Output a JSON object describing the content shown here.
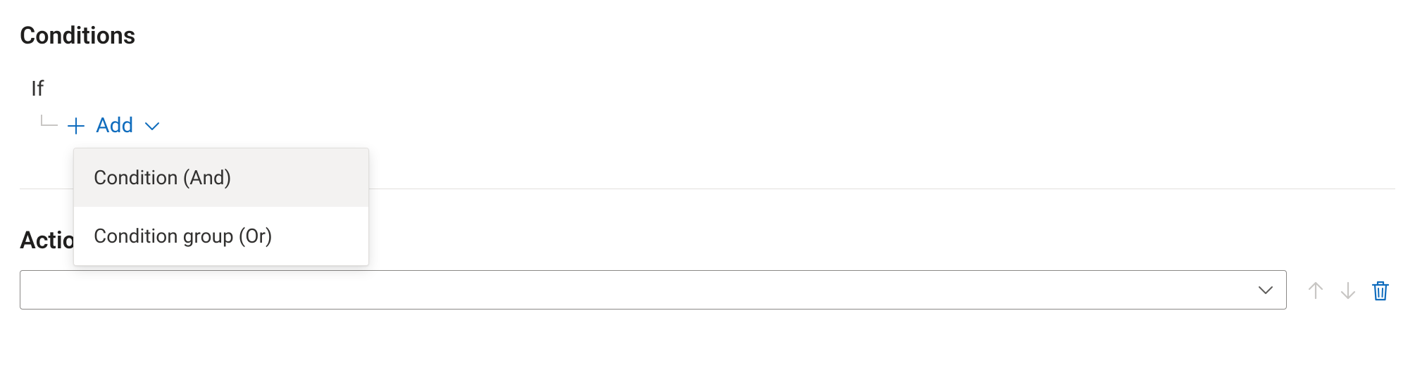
{
  "conditions": {
    "section_title": "Conditions",
    "if_label": "If",
    "add_label": "Add",
    "menu": [
      {
        "label": "Condition (And)"
      },
      {
        "label": "Condition group (Or)"
      }
    ]
  },
  "actions": {
    "section_title": "Actions",
    "selected_value": ""
  },
  "colors": {
    "accent": "#0f6cbd",
    "text": "#323130",
    "border": "#8a8886",
    "divider": "#e1dfdd",
    "hover": "#f3f2f1",
    "disabled": "#c8c6c4"
  }
}
